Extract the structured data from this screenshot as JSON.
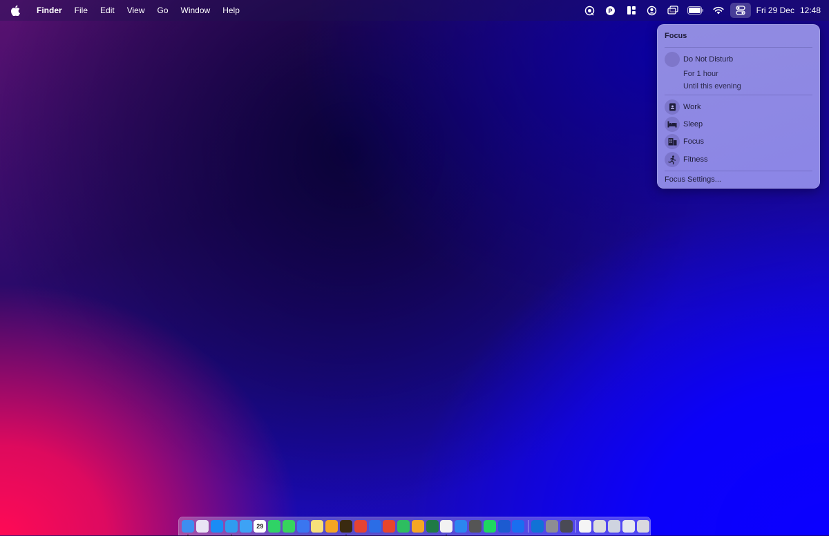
{
  "menubar": {
    "apple_icon": "apple-logo-icon",
    "app_name": "Finder",
    "menus": [
      "File",
      "Edit",
      "View",
      "Go",
      "Window",
      "Help"
    ],
    "status_icons": [
      "screen-time-icon",
      "pockity-icon",
      "window-manager-icon",
      "user-icon",
      "screen-mirroring-icon",
      "battery-icon",
      "wifi-icon",
      "control-center-icon"
    ],
    "date": "Fri 29 Dec",
    "time": "12:48"
  },
  "focus_panel": {
    "title": "Focus",
    "dnd": {
      "label": "Do Not Disturb",
      "icon": "moon-icon"
    },
    "dnd_options": [
      "For 1 hour",
      "Until this evening"
    ],
    "modes": [
      {
        "label": "Work",
        "icon": "badge-icon"
      },
      {
        "label": "Sleep",
        "icon": "bed-icon"
      },
      {
        "label": "Focus",
        "icon": "building-icon"
      },
      {
        "label": "Fitness",
        "icon": "running-icon"
      }
    ],
    "settings_label": "Focus Settings..."
  },
  "dock": {
    "calendar_day": "29",
    "apps": [
      {
        "name": "finder",
        "color": "#3d8ef0",
        "running": true
      },
      {
        "name": "launchpad",
        "color": "#e9e4f5",
        "running": false
      },
      {
        "name": "app-store",
        "color": "#1a8cf5",
        "running": false
      },
      {
        "name": "safari",
        "color": "#2f9cf0",
        "running": true
      },
      {
        "name": "mail",
        "color": "#3da2f5",
        "running": false
      },
      {
        "name": "calendar",
        "color": "#ffffff",
        "running": false
      },
      {
        "name": "whatsapp",
        "color": "#2fd366",
        "running": false
      },
      {
        "name": "messages",
        "color": "#36d45c",
        "running": false
      },
      {
        "name": "signal",
        "color": "#3a76f0",
        "running": false
      },
      {
        "name": "notes",
        "color": "#f7e07a",
        "running": false
      },
      {
        "name": "pages",
        "color": "#f5a623",
        "running": false
      },
      {
        "name": "tes",
        "color": "#3a2a10",
        "running": true
      },
      {
        "name": "todoist",
        "color": "#e44332",
        "running": false
      },
      {
        "name": "things",
        "color": "#2b6de6",
        "running": false
      },
      {
        "name": "craft",
        "color": "#e8452c",
        "running": false
      },
      {
        "name": "evernote",
        "color": "#2dbe60",
        "running": false
      },
      {
        "name": "pencil",
        "color": "#f6a623",
        "running": false
      },
      {
        "name": "excel",
        "color": "#1f7a45",
        "running": false
      },
      {
        "name": "photos",
        "color": "#f2f2f2",
        "running": true
      },
      {
        "name": "bookmarks",
        "color": "#2b86f0",
        "running": false
      },
      {
        "name": "calculator",
        "color": "#555555",
        "running": false
      },
      {
        "name": "spotify",
        "color": "#1ed760",
        "running": false
      },
      {
        "name": "prompt",
        "color": "#1c5bd1",
        "running": false
      },
      {
        "name": "1password",
        "color": "#1a6ef0",
        "running": false
      },
      {
        "name": "outlook",
        "color": "#1172d6",
        "running": false
      },
      {
        "name": "system-settings",
        "color": "#8d8d93",
        "running": false
      },
      {
        "name": "remote",
        "color": "#4a4a55",
        "running": false
      },
      {
        "name": "document",
        "color": "#f5f5f5",
        "running": false
      },
      {
        "name": "keyboard-viewer",
        "color": "#dddddd",
        "running": false
      },
      {
        "name": "screenshot-1",
        "color": "#cfd4e0",
        "running": false
      },
      {
        "name": "screenshot-2",
        "color": "#e6e8ef",
        "running": false
      },
      {
        "name": "trash",
        "color": "#d9d9df",
        "running": false
      }
    ]
  }
}
